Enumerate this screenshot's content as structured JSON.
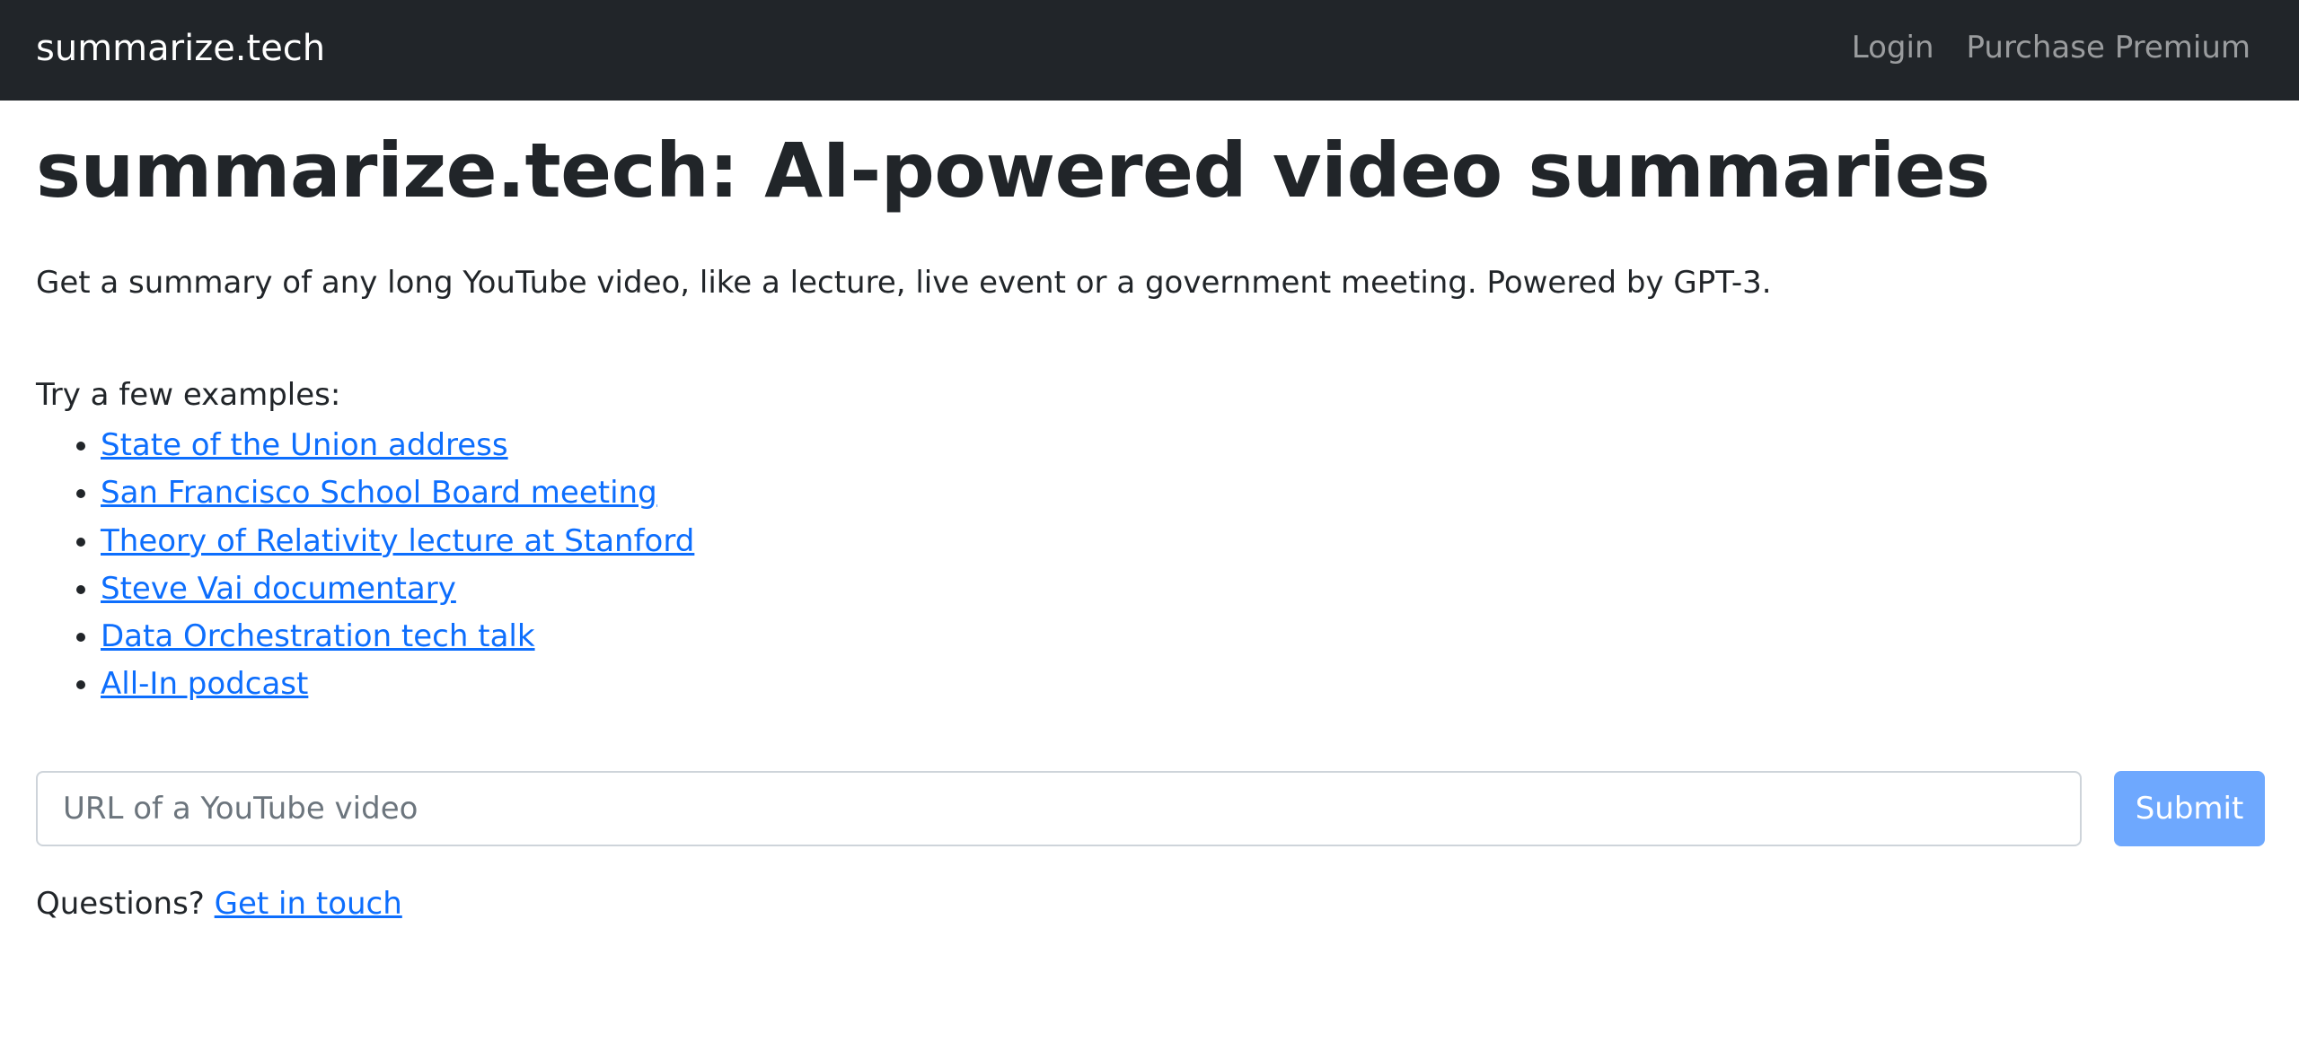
{
  "navbar": {
    "brand": "summarize.tech",
    "links": [
      {
        "label": "Login"
      },
      {
        "label": "Purchase Premium"
      }
    ],
    "background": "#212529"
  },
  "main": {
    "title": "summarize.tech: AI-powered video summaries",
    "lead": "Get a summary of any long YouTube video, like a lecture, live event or a government meeting. Powered by GPT-3.",
    "examples_label": "Try a few examples:",
    "examples": [
      {
        "label": "State of the Union address"
      },
      {
        "label": "San Francisco School Board meeting"
      },
      {
        "label": "Theory of Relativity lecture at Stanford"
      },
      {
        "label": "Steve Vai documentary"
      },
      {
        "label": "Data Orchestration tech talk"
      },
      {
        "label": "All-In podcast"
      }
    ],
    "url_input": {
      "value": "",
      "placeholder": "URL of a YouTube video"
    },
    "submit_label": "Submit",
    "footer": {
      "question": "Questions?",
      "link_label": "Get in touch"
    }
  },
  "colors": {
    "link": "#0d6efd",
    "submit_bg": "#6ea8fe",
    "text": "#212529"
  }
}
